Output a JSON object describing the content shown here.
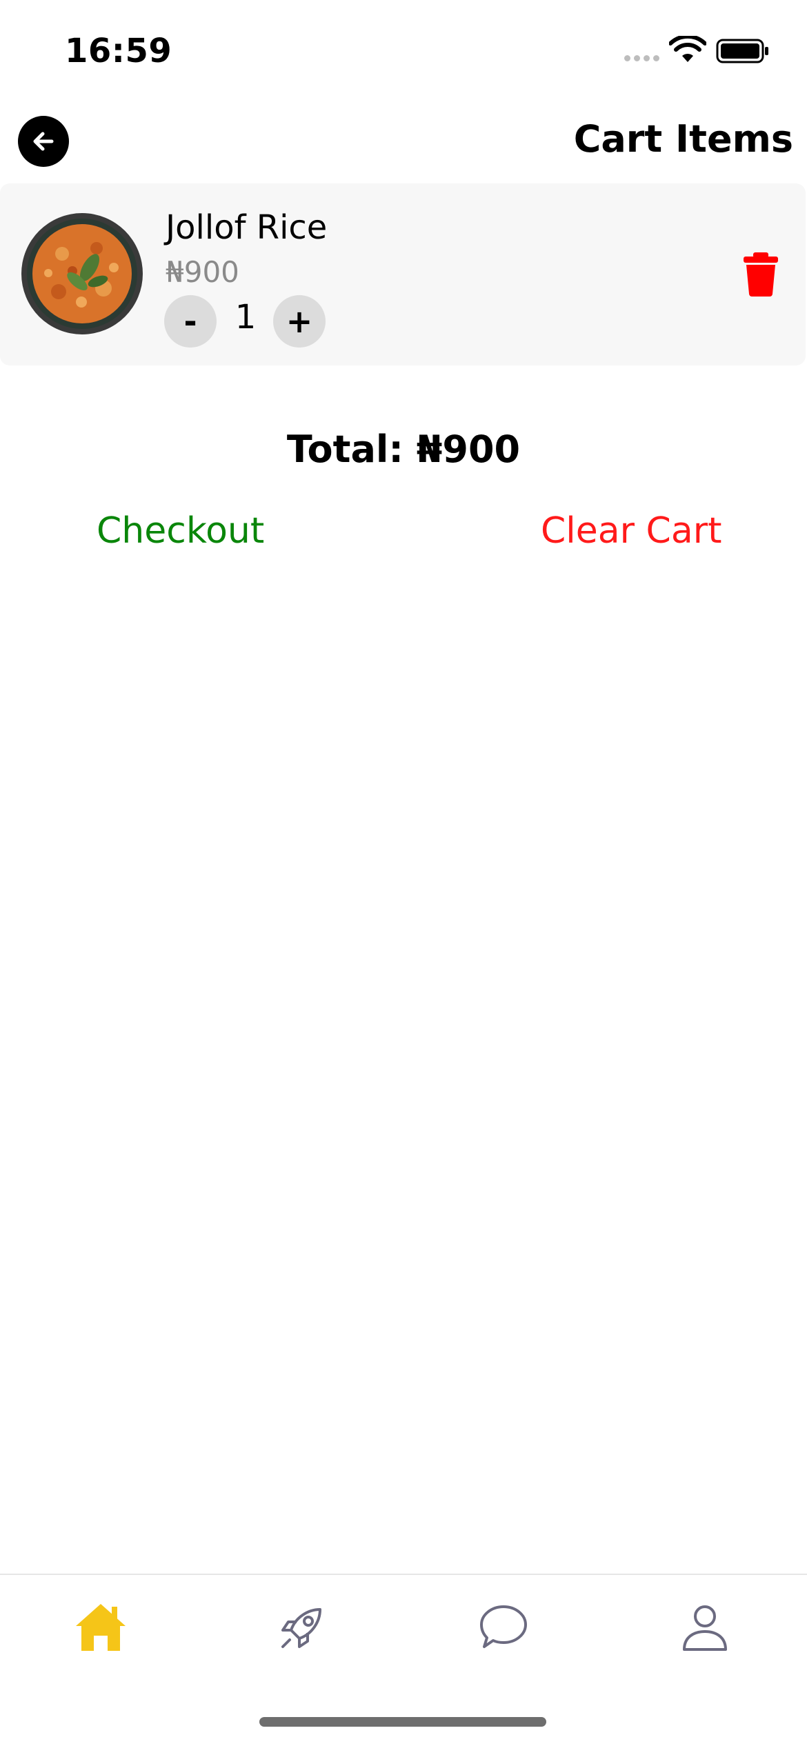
{
  "status_bar": {
    "time": "16:59"
  },
  "header": {
    "title": "Cart Items",
    "back_icon": "arrow-left-icon"
  },
  "cart": {
    "items": [
      {
        "name": "Jollof Rice",
        "price": "₦900",
        "quantity": "1",
        "minus_label": "-",
        "plus_label": "+",
        "image_icon": "jollof-rice-photo",
        "delete_icon": "trash-icon"
      }
    ],
    "total": "Total: ₦900",
    "checkout_label": "Checkout",
    "clear_label": "Clear Cart"
  },
  "tab_bar": {
    "items": [
      {
        "icon": "home-icon",
        "active": true
      },
      {
        "icon": "rocket-icon",
        "active": false
      },
      {
        "icon": "chat-icon",
        "active": false
      },
      {
        "icon": "profile-icon",
        "active": false
      }
    ]
  },
  "colors": {
    "checkout": "#0a860a",
    "clear_cart": "#ff1a1a",
    "delete_icon": "#ff0000",
    "active_tab": "#f5c518",
    "inactive_tab": "#6b6a80",
    "card_background": "#f7f7f7"
  }
}
